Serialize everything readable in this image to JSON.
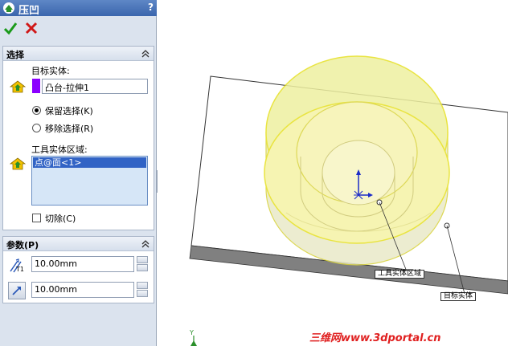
{
  "panel": {
    "title": "压凹",
    "help": "?",
    "icons": {
      "title": "indent-feature-icon",
      "ok": "checkmark-icon",
      "cancel": "x-icon"
    }
  },
  "selection_group": {
    "title": "选择",
    "target_label": "目标实体:",
    "target_value": "凸台-拉伸1",
    "target_color": "#8b00ff",
    "radio_keep": "保留选择(K)",
    "radio_remove": "移除选择(R)",
    "keep_selected": true,
    "tool_label": "工具实体区域:",
    "tool_items": [
      "点@面<1>"
    ],
    "cut_label": "切除(C)",
    "cut_checked": false
  },
  "params_group": {
    "title": "参数(P)",
    "thickness_value": "10.00mm",
    "clearance_value": "10.00mm",
    "thickness_icon_label": "T1"
  },
  "viewport": {
    "callout_tool": "工具实体区域",
    "callout_target": "目标实体",
    "triad_label": "Y",
    "watermark": "三维网www.3dportal.cn"
  },
  "colors": {
    "title_bar": "#3b66ad",
    "panel_bg": "#dbe3ee",
    "highlight_yellow": "#f5f08a",
    "selected_item": "#3163c5"
  }
}
